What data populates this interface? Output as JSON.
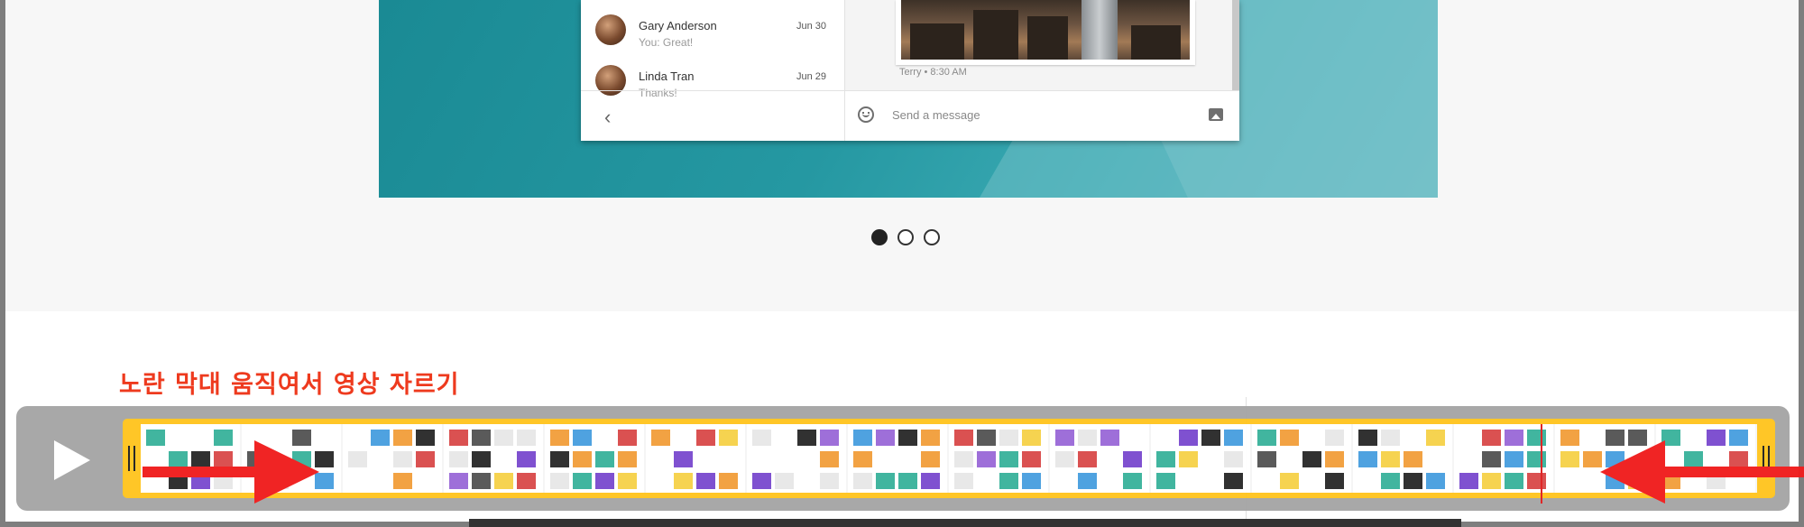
{
  "page": {
    "background_colors": {
      "band": "#f7f7f7",
      "content": "#ffffff",
      "hero": "#2598a2"
    }
  },
  "hero": {
    "conversations": [
      {
        "name": "Gary Anderson",
        "preview": "You: Great!",
        "date": "Jun 30"
      },
      {
        "name": "Linda Tran",
        "preview": "Thanks!",
        "date": "Jun 29"
      }
    ],
    "chat": {
      "photo_caption": "Terry • 8:30 AM",
      "compose_placeholder": "Send a message"
    },
    "icons": [
      "back-chevron-icon",
      "emoji-icon",
      "image-icon"
    ]
  },
  "carousel": {
    "slides": [
      {
        "active": true
      },
      {
        "active": false
      },
      {
        "active": false
      }
    ]
  },
  "annotation": {
    "text": "노란 막대 움직여서 영상 자르기",
    "color": "#ee3a1e"
  },
  "trimmer": {
    "window_color": "#ffc521",
    "bar_color": "#a6a6a6",
    "playhead_color": "#e02020",
    "arrow_color": "#f01d1d",
    "frame_count": 16
  }
}
